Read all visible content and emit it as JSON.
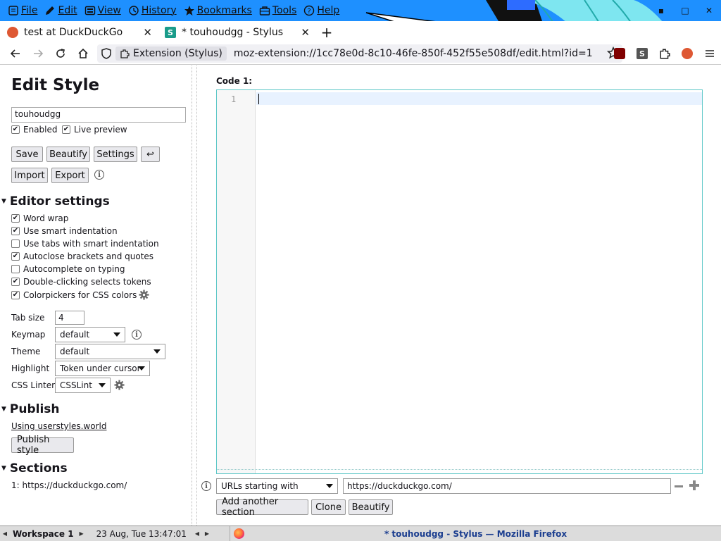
{
  "menubar": {
    "items": [
      {
        "label": "File",
        "icon": "file-icon"
      },
      {
        "label": "Edit",
        "icon": "pencil-icon"
      },
      {
        "label": "View",
        "icon": "view-icon"
      },
      {
        "label": "History",
        "icon": "history-icon"
      },
      {
        "label": "Bookmarks",
        "icon": "star-icon"
      },
      {
        "label": "Tools",
        "icon": "toolbox-icon"
      },
      {
        "label": "Help",
        "icon": "help-icon"
      }
    ]
  },
  "tabs": [
    {
      "title": "test at DuckDuckGo",
      "favicon": "duckduckgo-icon",
      "active": false
    },
    {
      "title": "* touhoudgg - Stylus",
      "favicon": "stylus-icon",
      "active": true
    }
  ],
  "navbar": {
    "extension_chip": "Extension (Stylus)",
    "url": "moz-extension://1cc78e0d-8c10-46fe-850f-452f55e508df/edit.html?id=1"
  },
  "editor_page": {
    "title": "Edit Style",
    "style_name": "touhoudgg",
    "enabled_label": "Enabled",
    "enabled": true,
    "live_preview_label": "Live preview",
    "live_preview": true,
    "buttons": {
      "save": "Save",
      "beautify": "Beautify",
      "settings": "Settings",
      "undo": "↩",
      "import": "Import",
      "export": "Export"
    },
    "editor_settings": {
      "heading": "Editor settings",
      "options": [
        {
          "label": "Word wrap",
          "checked": true
        },
        {
          "label": "Use smart indentation",
          "checked": true
        },
        {
          "label": "Use tabs with smart indentation",
          "checked": false
        },
        {
          "label": "Autoclose brackets and quotes",
          "checked": true
        },
        {
          "label": "Autocomplete on typing",
          "checked": false
        },
        {
          "label": "Double-clicking selects tokens",
          "checked": true
        },
        {
          "label": "Colorpickers for CSS colors",
          "checked": true
        }
      ],
      "tab_size_label": "Tab size",
      "tab_size": "4",
      "keymap_label": "Keymap",
      "keymap": "default",
      "theme_label": "Theme",
      "theme": "default",
      "highlight_label": "Highlight",
      "highlight": "Token under cursor",
      "linter_label": "CSS Linter",
      "linter": "CSSLint"
    },
    "publish": {
      "heading": "Publish",
      "link": "Using userstyles.world",
      "button": "Publish style"
    },
    "sections": {
      "heading": "Sections",
      "entries": [
        "1: https://duckduckgo.com/"
      ]
    }
  },
  "code": {
    "label": "Code 1:",
    "line_numbers": [
      "1"
    ],
    "applies_to_type": "URLs starting with",
    "applies_to_value": "https://duckduckgo.com/",
    "buttons": {
      "add_section": "Add another section",
      "clone": "Clone",
      "beautify": "Beautify"
    }
  },
  "taskbar": {
    "workspace": "Workspace 1",
    "clock": "23 Aug, Tue 13:47:01",
    "window_title": "* touhoudgg - Stylus — Mozilla Firefox"
  },
  "colors": {
    "titlebar": "#1e90ff",
    "editor_border": "#5cc7c7",
    "active_line": "#e8f2ff",
    "taskbar_title": "#1a3d8f"
  }
}
